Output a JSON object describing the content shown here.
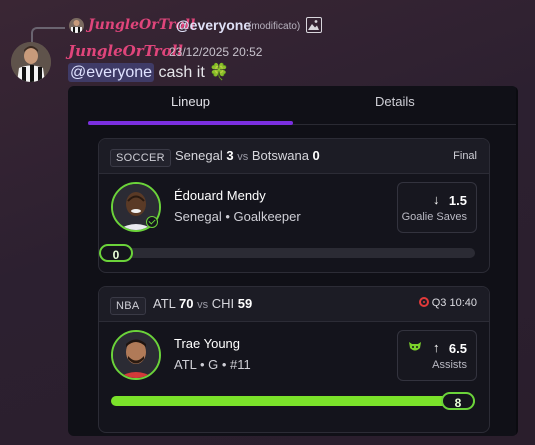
{
  "reply": {
    "author": "JungleOrTroll",
    "mention": "@everyone",
    "edited": "(modificato)"
  },
  "message": {
    "author": "JungleOrTroll",
    "timestamp": "23/12/2025 20:52",
    "mention": "@everyone",
    "text": "cash it 🍀"
  },
  "embed": {
    "tabs": [
      {
        "label": "Lineup",
        "active": true
      },
      {
        "label": "Details",
        "active": false
      }
    ],
    "games": [
      {
        "league": "SOCCER",
        "home": "Senegal",
        "home_score": "3",
        "vs": "vs",
        "away": "Botswana",
        "away_score": "0",
        "status": "Final",
        "player": {
          "name": "Édouard Mendy",
          "info": "Senegal • Goalkeeper",
          "line_value": "1.5",
          "direction": "down",
          "stat": "Goalie Saves",
          "current": "0",
          "progress": 0
        }
      },
      {
        "league": "NBA",
        "home": "ATL",
        "home_score": "70",
        "vs": "vs",
        "away": "CHI",
        "away_score": "59",
        "status": "Q3 10:40",
        "player": {
          "name": "Trae Young",
          "info": "ATL • G • #11",
          "line_value": "6.5",
          "direction": "up",
          "stat": "Assists",
          "current": "8",
          "progress": 1
        }
      }
    ]
  },
  "colors": {
    "accent": "#7b2fe0",
    "author": "#e0457b",
    "progress": "#7be22a",
    "live": "#e23a3a"
  },
  "icons": {
    "reply_image": "image-icon",
    "live": "live-dot-icon",
    "cat": "cat-face-icon",
    "check": "check-badge-icon"
  }
}
